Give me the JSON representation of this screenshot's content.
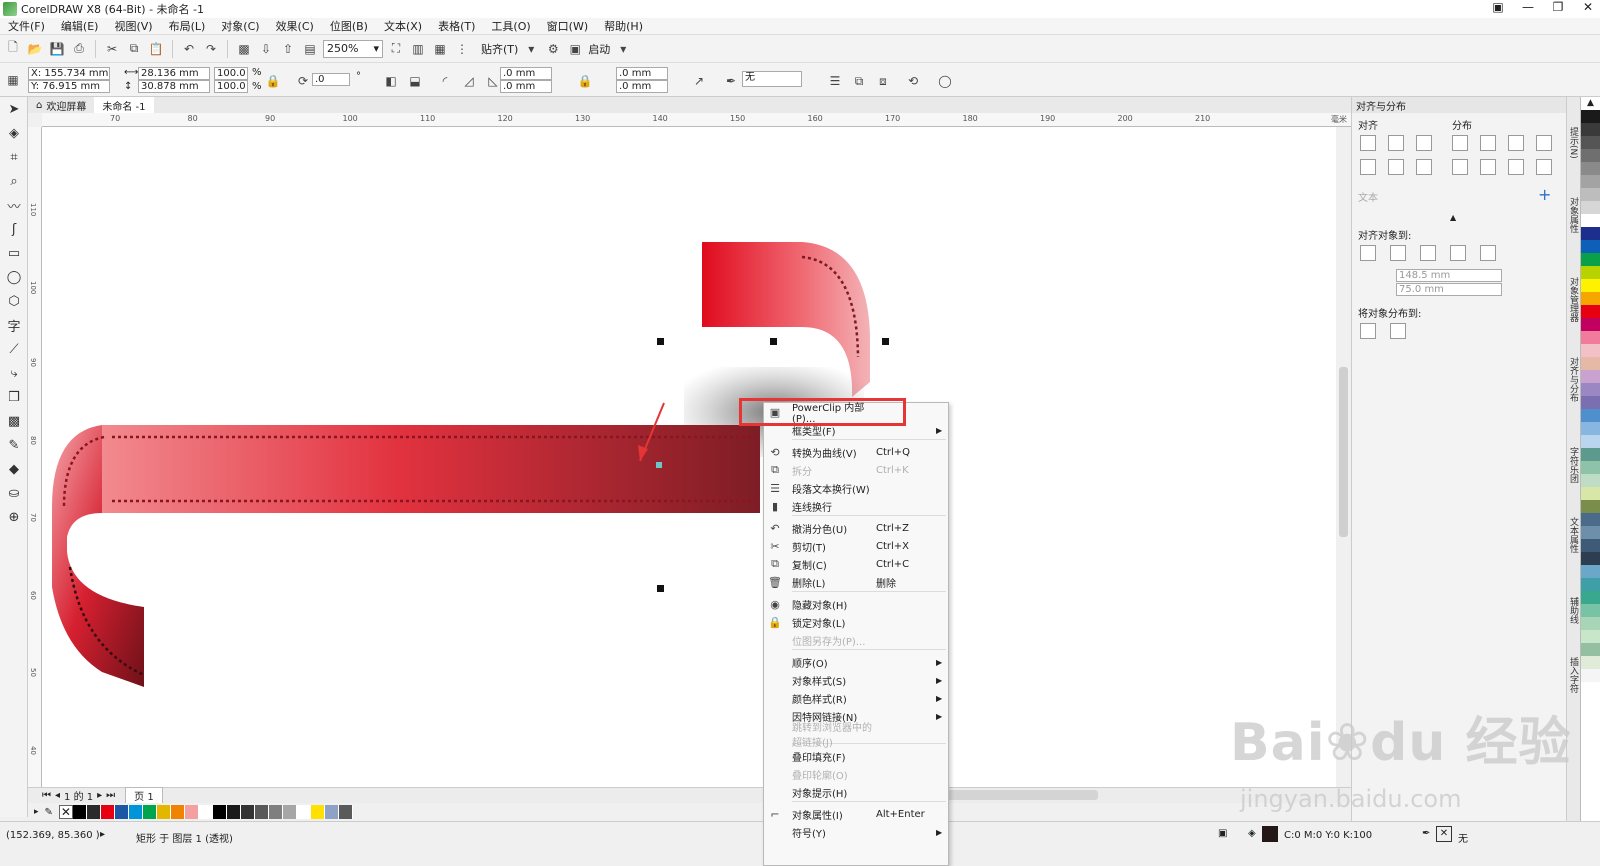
{
  "window": {
    "title": "CorelDRAW X8 (64-Bit) - 未命名 -1",
    "controls": [
      "restore-small",
      "minimize",
      "maximize",
      "close"
    ]
  },
  "menubar": [
    "文件(F)",
    "编辑(E)",
    "视图(V)",
    "布局(L)",
    "对象(C)",
    "效果(C)",
    "位图(B)",
    "文本(X)",
    "表格(T)",
    "工具(O)",
    "窗口(W)",
    "帮助(H)"
  ],
  "toolbar": {
    "zoom": "250%",
    "snap_label": "贴齐(T)",
    "launch_label": "启动"
  },
  "property_bar": {
    "x": "X: 155.734 mm",
    "y": "Y: 76.915 mm",
    "width": "28.136 mm",
    "height": "30.878 mm",
    "scale_w": "100.0",
    "scale_h": "100.0",
    "percent": "%",
    "rotation": ".0",
    "degree": "°",
    "corner1": ".0 mm",
    "corner2": ".0 mm",
    "corner3": ".0 mm",
    "corner4": ".0 mm",
    "outline": "无"
  },
  "doc_tabs": [
    "欢迎屏幕",
    "未命名 -1"
  ],
  "ruler": {
    "h_ticks": [
      "70",
      "80",
      "90",
      "100",
      "110",
      "120",
      "130",
      "140",
      "150",
      "160",
      "170",
      "180",
      "190",
      "200",
      "210"
    ],
    "v_ticks": [
      "110",
      "100",
      "90",
      "80",
      "70",
      "60",
      "50",
      "40",
      "30"
    ],
    "unit": "毫米"
  },
  "page_nav": {
    "page_info": "1 的 1",
    "page_tab": "页 1"
  },
  "context_menu": {
    "items": [
      {
        "label": "PowerClip 内部(P)...",
        "shortcut": "",
        "submenu": false,
        "disabled": false,
        "icon": "powerclip-icon",
        "highlighted": true
      },
      {
        "label": "框类型(F)",
        "shortcut": "",
        "submenu": true,
        "disabled": false,
        "icon": ""
      },
      {
        "label": "转换为曲线(V)",
        "shortcut": "Ctrl+Q",
        "submenu": false,
        "disabled": false,
        "icon": "convert-curve-icon"
      },
      {
        "label": "拆分",
        "shortcut": "Ctrl+K",
        "submenu": false,
        "disabled": true,
        "icon": "break-apart-icon"
      },
      {
        "label": "段落文本换行(W)",
        "shortcut": "",
        "submenu": false,
        "disabled": false,
        "icon": "text-wrap-icon"
      },
      {
        "label": "连线换行",
        "shortcut": "",
        "submenu": false,
        "disabled": false,
        "icon": "line-wrap-icon"
      },
      {
        "label": "撤消分色(U)",
        "shortcut": "Ctrl+Z",
        "submenu": false,
        "disabled": false,
        "icon": "undo-icon"
      },
      {
        "label": "剪切(T)",
        "shortcut": "Ctrl+X",
        "submenu": false,
        "disabled": false,
        "icon": "cut-icon"
      },
      {
        "label": "复制(C)",
        "shortcut": "Ctrl+C",
        "submenu": false,
        "disabled": false,
        "icon": "copy-icon"
      },
      {
        "label": "删除(L)",
        "shortcut": "删除",
        "submenu": false,
        "disabled": false,
        "icon": "trash-icon"
      },
      {
        "label": "隐藏对象(H)",
        "shortcut": "",
        "submenu": false,
        "disabled": false,
        "icon": "eye-icon"
      },
      {
        "label": "锁定对象(L)",
        "shortcut": "",
        "submenu": false,
        "disabled": false,
        "icon": "lock-icon"
      },
      {
        "label": "位图另存为(P)...",
        "shortcut": "",
        "submenu": false,
        "disabled": true,
        "icon": ""
      },
      {
        "label": "顺序(O)",
        "shortcut": "",
        "submenu": true,
        "disabled": false,
        "icon": ""
      },
      {
        "label": "对象样式(S)",
        "shortcut": "",
        "submenu": true,
        "disabled": false,
        "icon": ""
      },
      {
        "label": "颜色样式(R)",
        "shortcut": "",
        "submenu": true,
        "disabled": false,
        "icon": ""
      },
      {
        "label": "因特网链接(N)",
        "shortcut": "",
        "submenu": true,
        "disabled": false,
        "icon": ""
      },
      {
        "label": "跳转到浏览器中的超链接(J)",
        "shortcut": "",
        "submenu": false,
        "disabled": true,
        "icon": ""
      },
      {
        "label": "叠印填充(F)",
        "shortcut": "",
        "submenu": false,
        "disabled": false,
        "icon": ""
      },
      {
        "label": "叠印轮廓(O)",
        "shortcut": "",
        "submenu": false,
        "disabled": true,
        "icon": ""
      },
      {
        "label": "对象提示(H)",
        "shortcut": "",
        "submenu": false,
        "disabled": false,
        "icon": ""
      },
      {
        "label": "对象属性(I)",
        "shortcut": "Alt+Enter",
        "submenu": false,
        "disabled": false,
        "icon": "properties-icon"
      },
      {
        "label": "符号(Y)",
        "shortcut": "",
        "submenu": true,
        "disabled": false,
        "icon": ""
      }
    ]
  },
  "align_panel": {
    "title": "对齐与分布",
    "align_label": "对齐",
    "distribute_label": "分布",
    "text_label": "文本",
    "align_to_label": "对齐对象到:",
    "x_value": "148.5 mm",
    "y_value": "75.0 mm",
    "distribute_to_label": "将对象分布到:"
  },
  "side_tabs": [
    "提示(N)",
    "对象属性",
    "对象管理器",
    "对齐与分布",
    "字符乐团",
    "文本属性",
    "辅助线",
    "插入字符"
  ],
  "status": {
    "cursor_pos": "(152.369, 85.360 )",
    "object_info": "矩形 于 图层 1 (透视)",
    "fill_info": "C:0 M:0 Y:0 K:100",
    "outline_info": "无"
  },
  "palette_colors": [
    "#000000",
    "#2b2b2b",
    "#e60012",
    "#1c57a5",
    "#0095d9",
    "#00a54f",
    "#e3b700",
    "#f08300",
    "#f5a0a0",
    "#ffffff",
    "#000000",
    "#1a1a1a",
    "#333333",
    "#595959",
    "#7f7f7f",
    "#a6a6a6",
    "#ffffff",
    "#ffe000",
    "#8ea2c6",
    "#5a5a5a"
  ],
  "side_colors": [
    "#1a1a1a",
    "#3a3a3a",
    "#555555",
    "#6f6f6f",
    "#8a8a8a",
    "#a3a3a3",
    "#bdbdbd",
    "#d6d6d6",
    "#ffffff",
    "#1c2f8c",
    "#0d5fb8",
    "#0aa04a",
    "#b8d200",
    "#fff200",
    "#f7a600",
    "#e60012",
    "#c20060",
    "#f07b9a",
    "#f3c0c8",
    "#e6b8a6",
    "#c9a2cf",
    "#9b87c2",
    "#7a6fb0",
    "#4f8fcd",
    "#87b6e0",
    "#b9d6ee",
    "#5d9a8e",
    "#8fc3a9",
    "#bfdcc4",
    "#d8e7a8",
    "#7a8d4a",
    "#4a6b8a",
    "#6e8faa",
    "#3e5a76",
    "#2c3e50",
    "#6aa7c8",
    "#3f9fa8",
    "#3aa78f",
    "#78c2a6",
    "#a7d5b6",
    "#c8e6c9",
    "#94bfa0",
    "#e0ecd8",
    "#f5f5f5"
  ]
}
